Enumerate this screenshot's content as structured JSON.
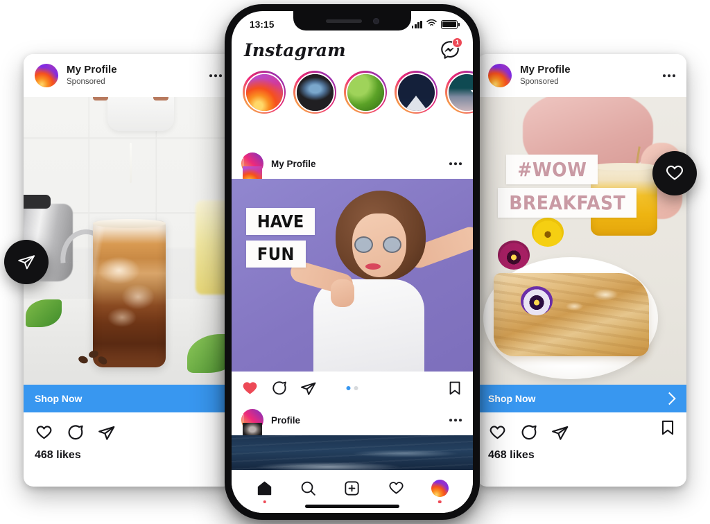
{
  "phone": {
    "status": {
      "time": "13:15",
      "signal_icon": "signal-bars-icon",
      "wifi_icon": "wifi-icon",
      "battery_icon": "battery-full-icon"
    },
    "app": {
      "logo_text": "Instagram",
      "messenger_icon": "messenger-icon",
      "messenger_badge": "1"
    },
    "stories": [
      {
        "name": "story-gradient",
        "thumb": "th1"
      },
      {
        "name": "story-person",
        "thumb": "th2"
      },
      {
        "name": "story-leaves",
        "thumb": "th3"
      },
      {
        "name": "story-mountain",
        "thumb": "th4"
      },
      {
        "name": "story-night",
        "thumb": "th5"
      }
    ],
    "posts": [
      {
        "username": "My Profile",
        "menu_icon": "more-options-icon",
        "sticker_line1": "HAVE",
        "sticker_line2": "FUN",
        "actions": {
          "like_icon": "heart-filled-icon",
          "comment_icon": "comment-icon",
          "share_icon": "share-icon",
          "save_icon": "bookmark-icon"
        },
        "carousel_dots": 2,
        "carousel_active": 1
      },
      {
        "username": "Profile",
        "menu_icon": "more-options-icon"
      }
    ],
    "tabbar": [
      {
        "name": "tab-home",
        "icon": "home-icon",
        "active": true
      },
      {
        "name": "tab-search",
        "icon": "search-icon",
        "active": false
      },
      {
        "name": "tab-create",
        "icon": "plus-square-icon",
        "active": false
      },
      {
        "name": "tab-activity",
        "icon": "heart-icon",
        "active": false
      },
      {
        "name": "tab-profile",
        "icon": "profile-avatar-icon",
        "active": true
      }
    ]
  },
  "left_card": {
    "username": "My Profile",
    "subtitle": "Sponsored",
    "menu_icon": "more-options-icon",
    "photo_alt": "iced-coffee-photo",
    "cta_label": "Shop Now",
    "like_icon": "heart-icon",
    "comment_icon": "comment-icon",
    "share_icon": "share-icon",
    "likes_text": "468 likes"
  },
  "right_card": {
    "username": "My Profile",
    "subtitle": "Sponsored",
    "menu_icon": "more-options-icon",
    "photo_alt": "crepes-breakfast-photo",
    "sticker_line1": "#WOW",
    "sticker_line2": "BREAKFAST",
    "cta_label": "Shop Now",
    "cta_chevron_icon": "chevron-right-icon",
    "like_icon": "heart-icon",
    "comment_icon": "comment-icon",
    "share_icon": "share-icon",
    "save_icon": "bookmark-icon",
    "likes_text": "468 likes"
  },
  "floating_buttons": [
    {
      "name": "floating-share-button",
      "icon": "share-icon"
    },
    {
      "name": "floating-like-button",
      "icon": "heart-icon"
    }
  ],
  "colors": {
    "cta_blue": "#3897f0",
    "badge_red": "#ed4956",
    "sticker_pink": "#c99aa4",
    "post_purple": "#8476c2"
  }
}
